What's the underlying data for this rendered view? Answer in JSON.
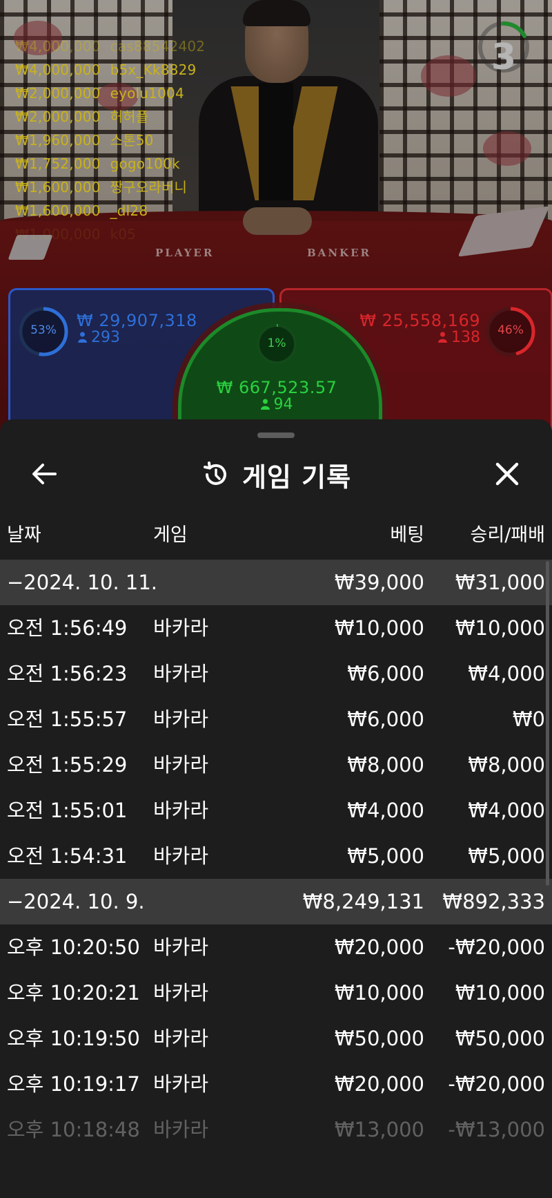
{
  "feed": [
    {
      "amount": "₩4,000,000",
      "name": "cas88542402"
    },
    {
      "amount": "₩4,000,000",
      "name": "b5x_Kk8829"
    },
    {
      "amount": "₩2,000,000",
      "name": "eyolu1004"
    },
    {
      "amount": "₩2,000,000",
      "name": "허허플"
    },
    {
      "amount": "₩1,960,000",
      "name": "스톤50"
    },
    {
      "amount": "₩1,752,000",
      "name": "gogo100k"
    },
    {
      "amount": "₩1,600,000",
      "name": "짱구오라버니"
    },
    {
      "amount": "₩1,600,000",
      "name": "_dl28"
    },
    {
      "amount": "₩1,000,000",
      "name": "k05"
    }
  ],
  "countdown": "3",
  "table_labels": {
    "player": "PLAYER",
    "banker": "BANKER"
  },
  "bets": {
    "player": {
      "percent": "53%",
      "amount": "₩ 29,907,318",
      "count": "293",
      "fraction": 0.53,
      "color": "#2f6fd8"
    },
    "banker": {
      "percent": "46%",
      "amount": "₩ 25,558,169",
      "count": "138",
      "fraction": 0.46,
      "color": "#d8262b"
    },
    "tie": {
      "percent": "1%",
      "amount": "₩ 667,523.57",
      "count": "94",
      "fraction": 0.01,
      "color": "#22b536"
    }
  },
  "sheet": {
    "title": "게임 기록",
    "columns": {
      "date": "날짜",
      "game": "게임",
      "bet": "베팅",
      "result": "승리/패배"
    }
  },
  "rows": [
    {
      "type": "date",
      "label": "−2024. 10. 11.",
      "game": "",
      "bet": "₩39,000",
      "result": "₩31,000"
    },
    {
      "type": "item",
      "label": "오전 1:56:49",
      "game": "바카라",
      "bet": "₩10,000",
      "result": "₩10,000"
    },
    {
      "type": "item",
      "label": "오전 1:56:23",
      "game": "바카라",
      "bet": "₩6,000",
      "result": "₩4,000"
    },
    {
      "type": "item",
      "label": "오전 1:55:57",
      "game": "바카라",
      "bet": "₩6,000",
      "result": "₩0"
    },
    {
      "type": "item",
      "label": "오전 1:55:29",
      "game": "바카라",
      "bet": "₩8,000",
      "result": "₩8,000"
    },
    {
      "type": "item",
      "label": "오전 1:55:01",
      "game": "바카라",
      "bet": "₩4,000",
      "result": "₩4,000"
    },
    {
      "type": "item",
      "label": "오전 1:54:31",
      "game": "바카라",
      "bet": "₩5,000",
      "result": "₩5,000"
    },
    {
      "type": "date",
      "label": "−2024. 10. 9.",
      "game": "",
      "bet": "₩8,249,131",
      "result": "₩892,333"
    },
    {
      "type": "item",
      "label": "오후 10:20:50",
      "game": "바카라",
      "bet": "₩20,000",
      "result": "-₩20,000"
    },
    {
      "type": "item",
      "label": "오후 10:20:21",
      "game": "바카라",
      "bet": "₩10,000",
      "result": "₩10,000"
    },
    {
      "type": "item",
      "label": "오후 10:19:50",
      "game": "바카라",
      "bet": "₩50,000",
      "result": "₩50,000"
    },
    {
      "type": "item",
      "label": "오후 10:19:17",
      "game": "바카라",
      "bet": "₩20,000",
      "result": "-₩20,000"
    },
    {
      "type": "item",
      "label": "오후 10:18:48",
      "game": "바카라",
      "bet": "₩13,000",
      "result": "-₩13,000",
      "faded": true
    }
  ]
}
